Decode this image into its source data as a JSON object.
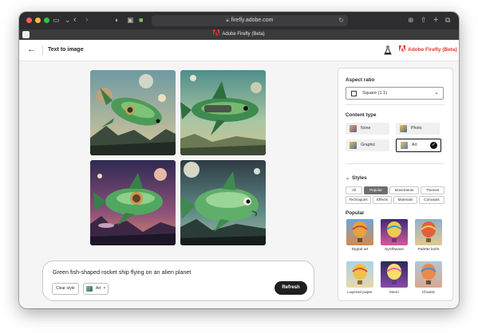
{
  "browser": {
    "url": "firefly.adobe.com",
    "tab_title": "Adobe Firefly (Beta)"
  },
  "header": {
    "title": "Text to image",
    "brand": "Adobe Firefly (Beta)"
  },
  "prompt": {
    "text": "Green fish-shaped rocket ship flying on an alien planet",
    "clear_style_label": "Clear style",
    "chip_label": "Art",
    "chip_remove": "×",
    "refresh_label": "Refresh"
  },
  "panel": {
    "aspect_ratio": {
      "heading": "Aspect ratio",
      "value": "Square (1:1)"
    },
    "content_type": {
      "heading": "Content type",
      "options": [
        {
          "label": "None"
        },
        {
          "label": "Photo"
        },
        {
          "label": "Graphic"
        },
        {
          "label": "Art",
          "selected": true
        }
      ]
    },
    "styles": {
      "heading": "Styles",
      "tabs": [
        "All",
        "Popular",
        "Movements",
        "Themes",
        "Techniques",
        "Effects",
        "Materials",
        "Concepts"
      ],
      "active_tab": "Popular",
      "section_heading": "Popular",
      "items": [
        "Digital art",
        "Synthwave",
        "Palette knife",
        "Layered paper",
        "Neon",
        "Chaotic"
      ]
    }
  },
  "colors": {
    "brand_red": "#e4352b",
    "refresh_bg": "#1f1f1f",
    "window_bg": "#f5f5f5"
  }
}
